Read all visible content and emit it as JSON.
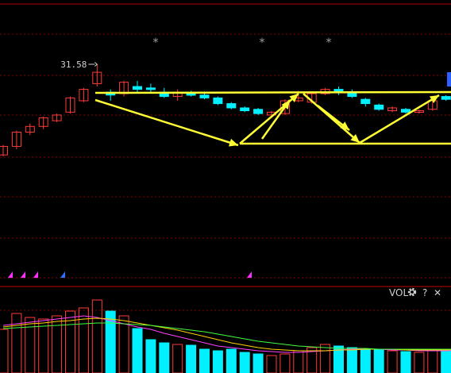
{
  "chart_data": [
    {
      "type": "candlestick",
      "panel": "price",
      "price_label": "31.58",
      "star_marker": "*",
      "candles": [
        {
          "o": 28.4,
          "c": 28.7,
          "h": 28.75,
          "l": 28.35
        },
        {
          "o": 28.7,
          "c": 29.2,
          "h": 29.25,
          "l": 28.6
        },
        {
          "o": 29.2,
          "c": 29.4,
          "h": 29.5,
          "l": 29.1
        },
        {
          "o": 29.4,
          "c": 29.7,
          "h": 29.75,
          "l": 29.3
        },
        {
          "o": 29.6,
          "c": 29.8,
          "h": 29.85,
          "l": 29.55
        },
        {
          "o": 29.9,
          "c": 30.4,
          "h": 30.45,
          "l": 29.85
        },
        {
          "o": 30.3,
          "c": 30.7,
          "h": 30.75,
          "l": 30.25
        },
        {
          "o": 30.9,
          "c": 31.3,
          "h": 31.58,
          "l": 30.8
        },
        {
          "o": 30.6,
          "c": 30.5,
          "h": 30.7,
          "l": 30.3
        },
        {
          "o": 30.55,
          "c": 30.95,
          "h": 31.0,
          "l": 30.45
        },
        {
          "o": 30.8,
          "c": 30.7,
          "h": 31.0,
          "l": 30.6
        },
        {
          "o": 30.75,
          "c": 30.7,
          "h": 30.9,
          "l": 30.6
        },
        {
          "o": 30.6,
          "c": 30.45,
          "h": 30.75,
          "l": 30.4
        },
        {
          "o": 30.45,
          "c": 30.6,
          "h": 30.7,
          "l": 30.3
        },
        {
          "o": 30.55,
          "c": 30.5,
          "h": 30.65,
          "l": 30.45
        },
        {
          "o": 30.5,
          "c": 30.4,
          "h": 30.6,
          "l": 30.35
        },
        {
          "o": 30.4,
          "c": 30.2,
          "h": 30.45,
          "l": 30.15
        },
        {
          "o": 30.2,
          "c": 30.05,
          "h": 30.25,
          "l": 30.0
        },
        {
          "o": 30.05,
          "c": 29.95,
          "h": 30.1,
          "l": 29.9
        },
        {
          "o": 30.0,
          "c": 29.85,
          "h": 30.05,
          "l": 29.8
        },
        {
          "o": 29.8,
          "c": 29.9,
          "h": 29.95,
          "l": 29.7
        },
        {
          "o": 29.85,
          "c": 30.3,
          "h": 30.35,
          "l": 29.8
        },
        {
          "o": 30.3,
          "c": 30.4,
          "h": 30.65,
          "l": 30.25
        },
        {
          "o": 30.25,
          "c": 30.55,
          "h": 30.6,
          "l": 30.2
        },
        {
          "o": 30.55,
          "c": 30.7,
          "h": 30.75,
          "l": 30.5
        },
        {
          "o": 30.7,
          "c": 30.6,
          "h": 30.8,
          "l": 30.5
        },
        {
          "o": 30.6,
          "c": 30.45,
          "h": 30.7,
          "l": 30.4
        },
        {
          "o": 30.35,
          "c": 30.2,
          "h": 30.4,
          "l": 30.1
        },
        {
          "o": 30.15,
          "c": 30.0,
          "h": 30.2,
          "l": 29.95
        },
        {
          "o": 29.95,
          "c": 30.05,
          "h": 30.1,
          "l": 29.9
        },
        {
          "o": 30.0,
          "c": 29.9,
          "h": 30.05,
          "l": 29.85
        },
        {
          "o": 29.9,
          "c": 29.95,
          "h": 30.0,
          "l": 29.85
        },
        {
          "o": 30.0,
          "c": 30.3,
          "h": 30.35,
          "l": 29.95
        },
        {
          "o": 30.45,
          "c": 30.35,
          "h": 30.5,
          "l": 30.3
        },
        {
          "o": 30.35,
          "c": 30.45,
          "h": 30.5,
          "l": 30.3
        }
      ],
      "volume": {
        "label": "VOL",
        "values": [
          55,
          75,
          70,
          68,
          72,
          78,
          82,
          92,
          78,
          72,
          56,
          42,
          38,
          36,
          35,
          30,
          28,
          30,
          26,
          24,
          22,
          24,
          28,
          32,
          36,
          34,
          32,
          30,
          29,
          28,
          27,
          26,
          28,
          30,
          44
        ],
        "ma": [
          {
            "color": "#ff40ff",
            "values": [
              60,
              62,
              64,
              66,
              68,
              70,
              72,
              70,
              66,
              62,
              58,
              55,
              50,
              46,
              42,
              38,
              34,
              32,
              30,
              28,
              27,
              26,
              26,
              27,
              28,
              29,
              30,
              30,
              30,
              29,
              29,
              28,
              28,
              28,
              29
            ]
          },
          {
            "color": "#ffd400",
            "values": [
              58,
              60,
              62,
              63,
              65,
              66,
              68,
              69,
              68,
              66,
              63,
              60,
              57,
              54,
              50,
              46,
              42,
              38,
              35,
              32,
              30,
              29,
              28,
              28,
              28,
              29,
              29,
              30,
              30,
              30,
              29,
              29,
              29,
              29,
              30
            ]
          },
          {
            "color": "#40ff40",
            "values": [
              56,
              57,
              58,
              59,
              60,
              61,
              62,
              63,
              63,
              62,
              61,
              60,
              58,
              56,
              54,
              52,
              49,
              46,
              43,
              40,
              38,
              36,
              34,
              33,
              32,
              31,
              31,
              31,
              30,
              30,
              30,
              30,
              30,
              30,
              30
            ]
          }
        ]
      },
      "bottom_markers": [
        "magenta",
        "magenta",
        "magenta",
        "blue",
        "magenta"
      ]
    }
  ],
  "colors": {
    "up": "#ff3a3a",
    "down": "#00f0ff",
    "annotation": "#ffff33",
    "grid": "#8b0000",
    "panel_separator": "#800000",
    "text": "#d0d0d0",
    "star": "#a0a0a0",
    "edge_marker": "#3060ff"
  },
  "toolbar": {
    "vol_label": "VOL",
    "gear_icon": "gear-icon",
    "help_label": "?",
    "close_label": "✕"
  }
}
